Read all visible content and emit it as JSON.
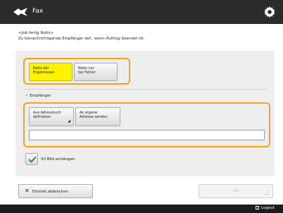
{
  "window": {
    "title": "Fax"
  },
  "header": {
    "line1": "<Job fertig Notiz>",
    "line2": "Zu benachrichtigende Empfänger def., wenn Auftrag beendet ist."
  },
  "notify": {
    "option_a": {
      "line1": "Notiz bei",
      "line2": "Ergebnissen"
    },
    "option_b": {
      "line1": "Notiz nur",
      "line2": "bei Fehler"
    },
    "selected": "option_a"
  },
  "recipient": {
    "label": "Empfänger",
    "address_book_button": {
      "line1": "Aus Adressbuch",
      "line2": "definieren"
    },
    "own_address_button": {
      "line1": "An eigene",
      "line2": "Adresse senden"
    },
    "address_value": ""
  },
  "attach": {
    "label": "S/I Bild anhängen",
    "checked": true
  },
  "footer": {
    "cancel_label": "Einstell.abbrechen",
    "ok_label": "OK"
  },
  "status": {
    "logout_label": "Logout"
  },
  "colors": {
    "highlight": "#f3a21c",
    "selected_button": "#fff200",
    "check": "#2e9e3c"
  },
  "icons": [
    "fax-app-icon",
    "gear-icon",
    "close-icon",
    "checkmark-icon",
    "logout-icon",
    "dropdown-caret-icon"
  ]
}
